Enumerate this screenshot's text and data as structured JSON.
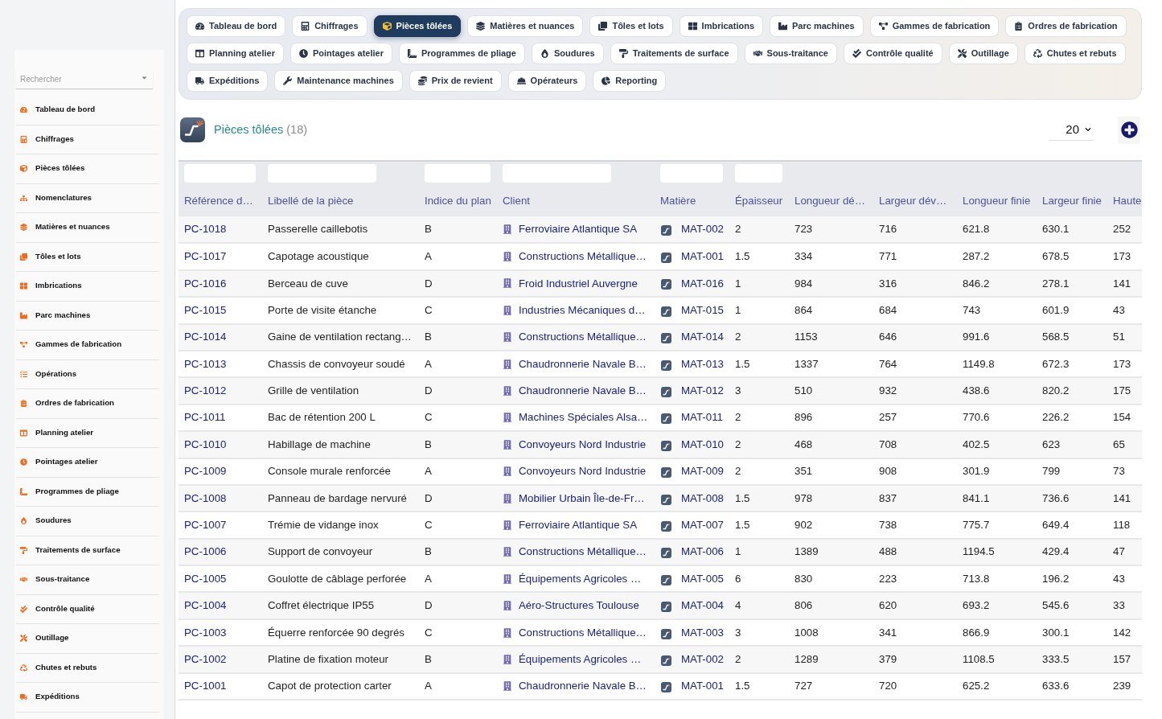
{
  "sidebar": {
    "search": {
      "placeholder": "Rechercher"
    },
    "items": [
      {
        "label": "Tableau de bord"
      },
      {
        "label": "Chiffrages"
      },
      {
        "label": "Pièces tôlées"
      },
      {
        "label": "Nomenclatures"
      },
      {
        "label": "Matières et nuances"
      },
      {
        "label": "Tôles et lots"
      },
      {
        "label": "Imbrications"
      },
      {
        "label": "Parc machines"
      },
      {
        "label": "Gammes de fabrication"
      },
      {
        "label": "Opérations"
      },
      {
        "label": "Ordres de fabrication"
      },
      {
        "label": "Planning atelier"
      },
      {
        "label": "Pointages atelier"
      },
      {
        "label": "Programmes de pliage"
      },
      {
        "label": "Soudures"
      },
      {
        "label": "Traitements de surface"
      },
      {
        "label": "Sous-traitance"
      },
      {
        "label": "Contrôle qualité"
      },
      {
        "label": "Outillage"
      },
      {
        "label": "Chutes et rebuts"
      },
      {
        "label": "Expéditions"
      }
    ]
  },
  "module_tabs": {
    "rows": [
      {
        "tabs": [
          {
            "label": "Tableau de bord",
            "selected": false
          },
          {
            "label": "Chiffrages",
            "selected": false
          },
          {
            "label": "Pièces tôlées",
            "selected": true
          },
          {
            "label": "Matières et nuances",
            "selected": false
          },
          {
            "label": "Tôles et lots",
            "selected": false
          },
          {
            "label": "Imbrications",
            "selected": false
          },
          {
            "label": "Parc machines",
            "selected": false
          },
          {
            "label": "Gammes de fabrication",
            "selected": false
          },
          {
            "label": "Ordres de fabrication",
            "selected": false
          }
        ]
      },
      {
        "tabs": [
          {
            "label": "Planning atelier",
            "selected": false
          },
          {
            "label": "Pointages atelier",
            "selected": false
          },
          {
            "label": "Programmes de pliage",
            "selected": false
          },
          {
            "label": "Soudures",
            "selected": false
          },
          {
            "label": "Traitements de surface",
            "selected": false
          },
          {
            "label": "Sous-traitance",
            "selected": false
          },
          {
            "label": "Contrôle qualité",
            "selected": false
          },
          {
            "label": "Outillage",
            "selected": false
          },
          {
            "label": "Chutes et rebuts",
            "selected": false
          }
        ]
      },
      {
        "tabs": [
          {
            "label": "Expéditions",
            "selected": false
          },
          {
            "label": "Maintenance machines",
            "selected": false
          },
          {
            "label": "Prix de revient",
            "selected": false
          },
          {
            "label": "Opérateurs",
            "selected": false
          },
          {
            "label": "Reporting",
            "selected": false
          }
        ]
      }
    ]
  },
  "page_header": {
    "title": "Pièces tôlées",
    "count": "(18)",
    "page_size": "20"
  },
  "table": {
    "columns": [
      {
        "label": "Référence d…",
        "kind": "link",
        "filter": true
      },
      {
        "label": "Libellé de la pièce",
        "kind": "text",
        "filter": true
      },
      {
        "label": "Indice du plan",
        "kind": "text",
        "filter": true
      },
      {
        "label": "Client",
        "kind": "client",
        "filter": true
      },
      {
        "label": "Matière",
        "kind": "material",
        "filter": true
      },
      {
        "label": "Épaisseur",
        "kind": "text",
        "filter": true
      },
      {
        "label": "Longueur dé…",
        "kind": "text",
        "filter": false
      },
      {
        "label": "Largeur dév…",
        "kind": "text",
        "filter": false
      },
      {
        "label": "Longueur finie",
        "kind": "text",
        "filter": false
      },
      {
        "label": "Largeur finie",
        "kind": "text",
        "filter": false
      },
      {
        "label": "Haute",
        "kind": "text",
        "filter": false
      }
    ],
    "rows": [
      {
        "cells": [
          "PC-1018",
          "Passerelle caillebotis",
          "B",
          "Ferroviaire Atlantique SA",
          "MAT-002",
          "2",
          "723",
          "716",
          "621.8",
          "630.1",
          "252"
        ]
      },
      {
        "cells": [
          "PC-1017",
          "Capotage acoustique",
          "A",
          "Constructions Métallique…",
          "MAT-001",
          "1.5",
          "334",
          "771",
          "287.2",
          "678.5",
          "173"
        ]
      },
      {
        "cells": [
          "PC-1016",
          "Berceau de cuve",
          "D",
          "Froid Industriel Auvergne",
          "MAT-016",
          "1",
          "984",
          "316",
          "846.2",
          "278.1",
          "141"
        ]
      },
      {
        "cells": [
          "PC-1015",
          "Porte de visite étanche",
          "C",
          "Industries Mécaniques d…",
          "MAT-015",
          "1",
          "864",
          "684",
          "743",
          "601.9",
          "43"
        ]
      },
      {
        "cells": [
          "PC-1014",
          "Gaine de ventilation rectang…",
          "B",
          "Constructions Métallique…",
          "MAT-014",
          "2",
          "1153",
          "646",
          "991.6",
          "568.5",
          "51"
        ]
      },
      {
        "cells": [
          "PC-1013",
          "Chassis de convoyeur soudé",
          "A",
          "Chaudronnerie Navale B…",
          "MAT-013",
          "1.5",
          "1337",
          "764",
          "1149.8",
          "672.3",
          "173"
        ]
      },
      {
        "cells": [
          "PC-1012",
          "Grille de ventilation",
          "D",
          "Chaudronnerie Navale B…",
          "MAT-012",
          "3",
          "510",
          "932",
          "438.6",
          "820.2",
          "175"
        ]
      },
      {
        "cells": [
          "PC-1011",
          "Bac de rétention 200 L",
          "C",
          "Machines Spéciales Alsa…",
          "MAT-011",
          "2",
          "896",
          "257",
          "770.6",
          "226.2",
          "154"
        ]
      },
      {
        "cells": [
          "PC-1010",
          "Habillage de machine",
          "B",
          "Convoyeurs Nord Industrie",
          "MAT-010",
          "2",
          "468",
          "708",
          "402.5",
          "623",
          "65"
        ]
      },
      {
        "cells": [
          "PC-1009",
          "Console murale renforcée",
          "A",
          "Convoyeurs Nord Industrie",
          "MAT-009",
          "2",
          "351",
          "908",
          "301.9",
          "799",
          "73"
        ]
      },
      {
        "cells": [
          "PC-1008",
          "Panneau de bardage nervuré",
          "D",
          "Mobilier Urbain Île-de-Fr…",
          "MAT-008",
          "1.5",
          "978",
          "837",
          "841.1",
          "736.6",
          "141"
        ]
      },
      {
        "cells": [
          "PC-1007",
          "Trémie de vidange inox",
          "C",
          "Ferroviaire Atlantique SA",
          "MAT-007",
          "1.5",
          "902",
          "738",
          "775.7",
          "649.4",
          "118"
        ]
      },
      {
        "cells": [
          "PC-1006",
          "Support de convoyeur",
          "B",
          "Constructions Métallique…",
          "MAT-006",
          "1",
          "1389",
          "488",
          "1194.5",
          "429.4",
          "47"
        ]
      },
      {
        "cells": [
          "PC-1005",
          "Goulotte de câblage perforée",
          "A",
          "Équipements Agricoles …",
          "MAT-005",
          "6",
          "830",
          "223",
          "713.8",
          "196.2",
          "43"
        ]
      },
      {
        "cells": [
          "PC-1004",
          "Coffret électrique IP55",
          "D",
          "Aéro-Structures Toulouse",
          "MAT-004",
          "4",
          "806",
          "620",
          "693.2",
          "545.6",
          "33"
        ]
      },
      {
        "cells": [
          "PC-1003",
          "Équerre renforcée 90 degrés",
          "C",
          "Constructions Métallique…",
          "MAT-003",
          "3",
          "1008",
          "341",
          "866.9",
          "300.1",
          "142"
        ]
      },
      {
        "cells": [
          "PC-1002",
          "Platine de fixation moteur",
          "B",
          "Équipements Agricoles …",
          "MAT-002",
          "2",
          "1289",
          "379",
          "1108.5",
          "333.5",
          "157"
        ]
      },
      {
        "cells": [
          "PC-1001",
          "Capot de protection carter",
          "A",
          "Chaudronnerie Navale B…",
          "MAT-001",
          "1.5",
          "727",
          "720",
          "625.2",
          "633.6",
          "239"
        ]
      }
    ]
  }
}
